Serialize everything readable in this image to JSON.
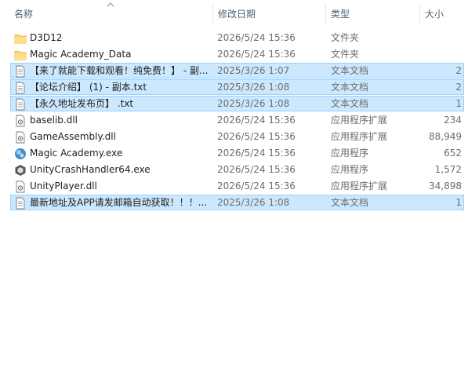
{
  "columns": {
    "name": "名称",
    "date": "修改日期",
    "type": "类型",
    "size": "大小"
  },
  "files": [
    {
      "icon": "folder-icon",
      "name": "D3D12",
      "date": "2026/5/24 15:36",
      "type": "文件夹",
      "size": "",
      "selected": false
    },
    {
      "icon": "folder-icon",
      "name": "Magic Academy_Data",
      "date": "2026/5/24 15:36",
      "type": "文件夹",
      "size": "",
      "selected": false
    },
    {
      "icon": "text-file-icon",
      "name": "【来了就能下载和观看！纯免费！】 - 副...",
      "date": "2025/3/26 1:07",
      "type": "文本文档",
      "size": "2",
      "selected": true
    },
    {
      "icon": "text-file-icon",
      "name": "【论坛介绍】 (1) - 副本.txt",
      "date": "2025/3/26 1:08",
      "type": "文本文档",
      "size": "2",
      "selected": true
    },
    {
      "icon": "text-file-icon",
      "name": "【永久地址发布页】 .txt",
      "date": "2025/3/26 1:08",
      "type": "文本文档",
      "size": "1",
      "selected": true
    },
    {
      "icon": "dll-file-icon",
      "name": "baselib.dll",
      "date": "2026/5/24 15:36",
      "type": "应用程序扩展",
      "size": "234",
      "selected": false
    },
    {
      "icon": "dll-file-icon",
      "name": "GameAssembly.dll",
      "date": "2026/5/24 15:36",
      "type": "应用程序扩展",
      "size": "88,949",
      "selected": false
    },
    {
      "icon": "game-app-icon",
      "name": "Magic Academy.exe",
      "date": "2026/5/24 15:36",
      "type": "应用程序",
      "size": "652",
      "selected": false
    },
    {
      "icon": "unity-app-icon",
      "name": "UnityCrashHandler64.exe",
      "date": "2026/5/24 15:36",
      "type": "应用程序",
      "size": "1,572",
      "selected": false
    },
    {
      "icon": "dll-file-icon",
      "name": "UnityPlayer.dll",
      "date": "2026/5/24 15:36",
      "type": "应用程序扩展",
      "size": "34,898",
      "selected": false
    },
    {
      "icon": "text-file-icon",
      "name": "最新地址及APP请发邮箱自动获取！！！...",
      "date": "2025/3/26 1:08",
      "type": "文本文档",
      "size": "1",
      "selected": true
    }
  ],
  "colors": {
    "selection_bg": "#cce8ff",
    "selection_border": "#99d1ff",
    "header_text": "#4c607a",
    "folder": "#ffd66b"
  }
}
